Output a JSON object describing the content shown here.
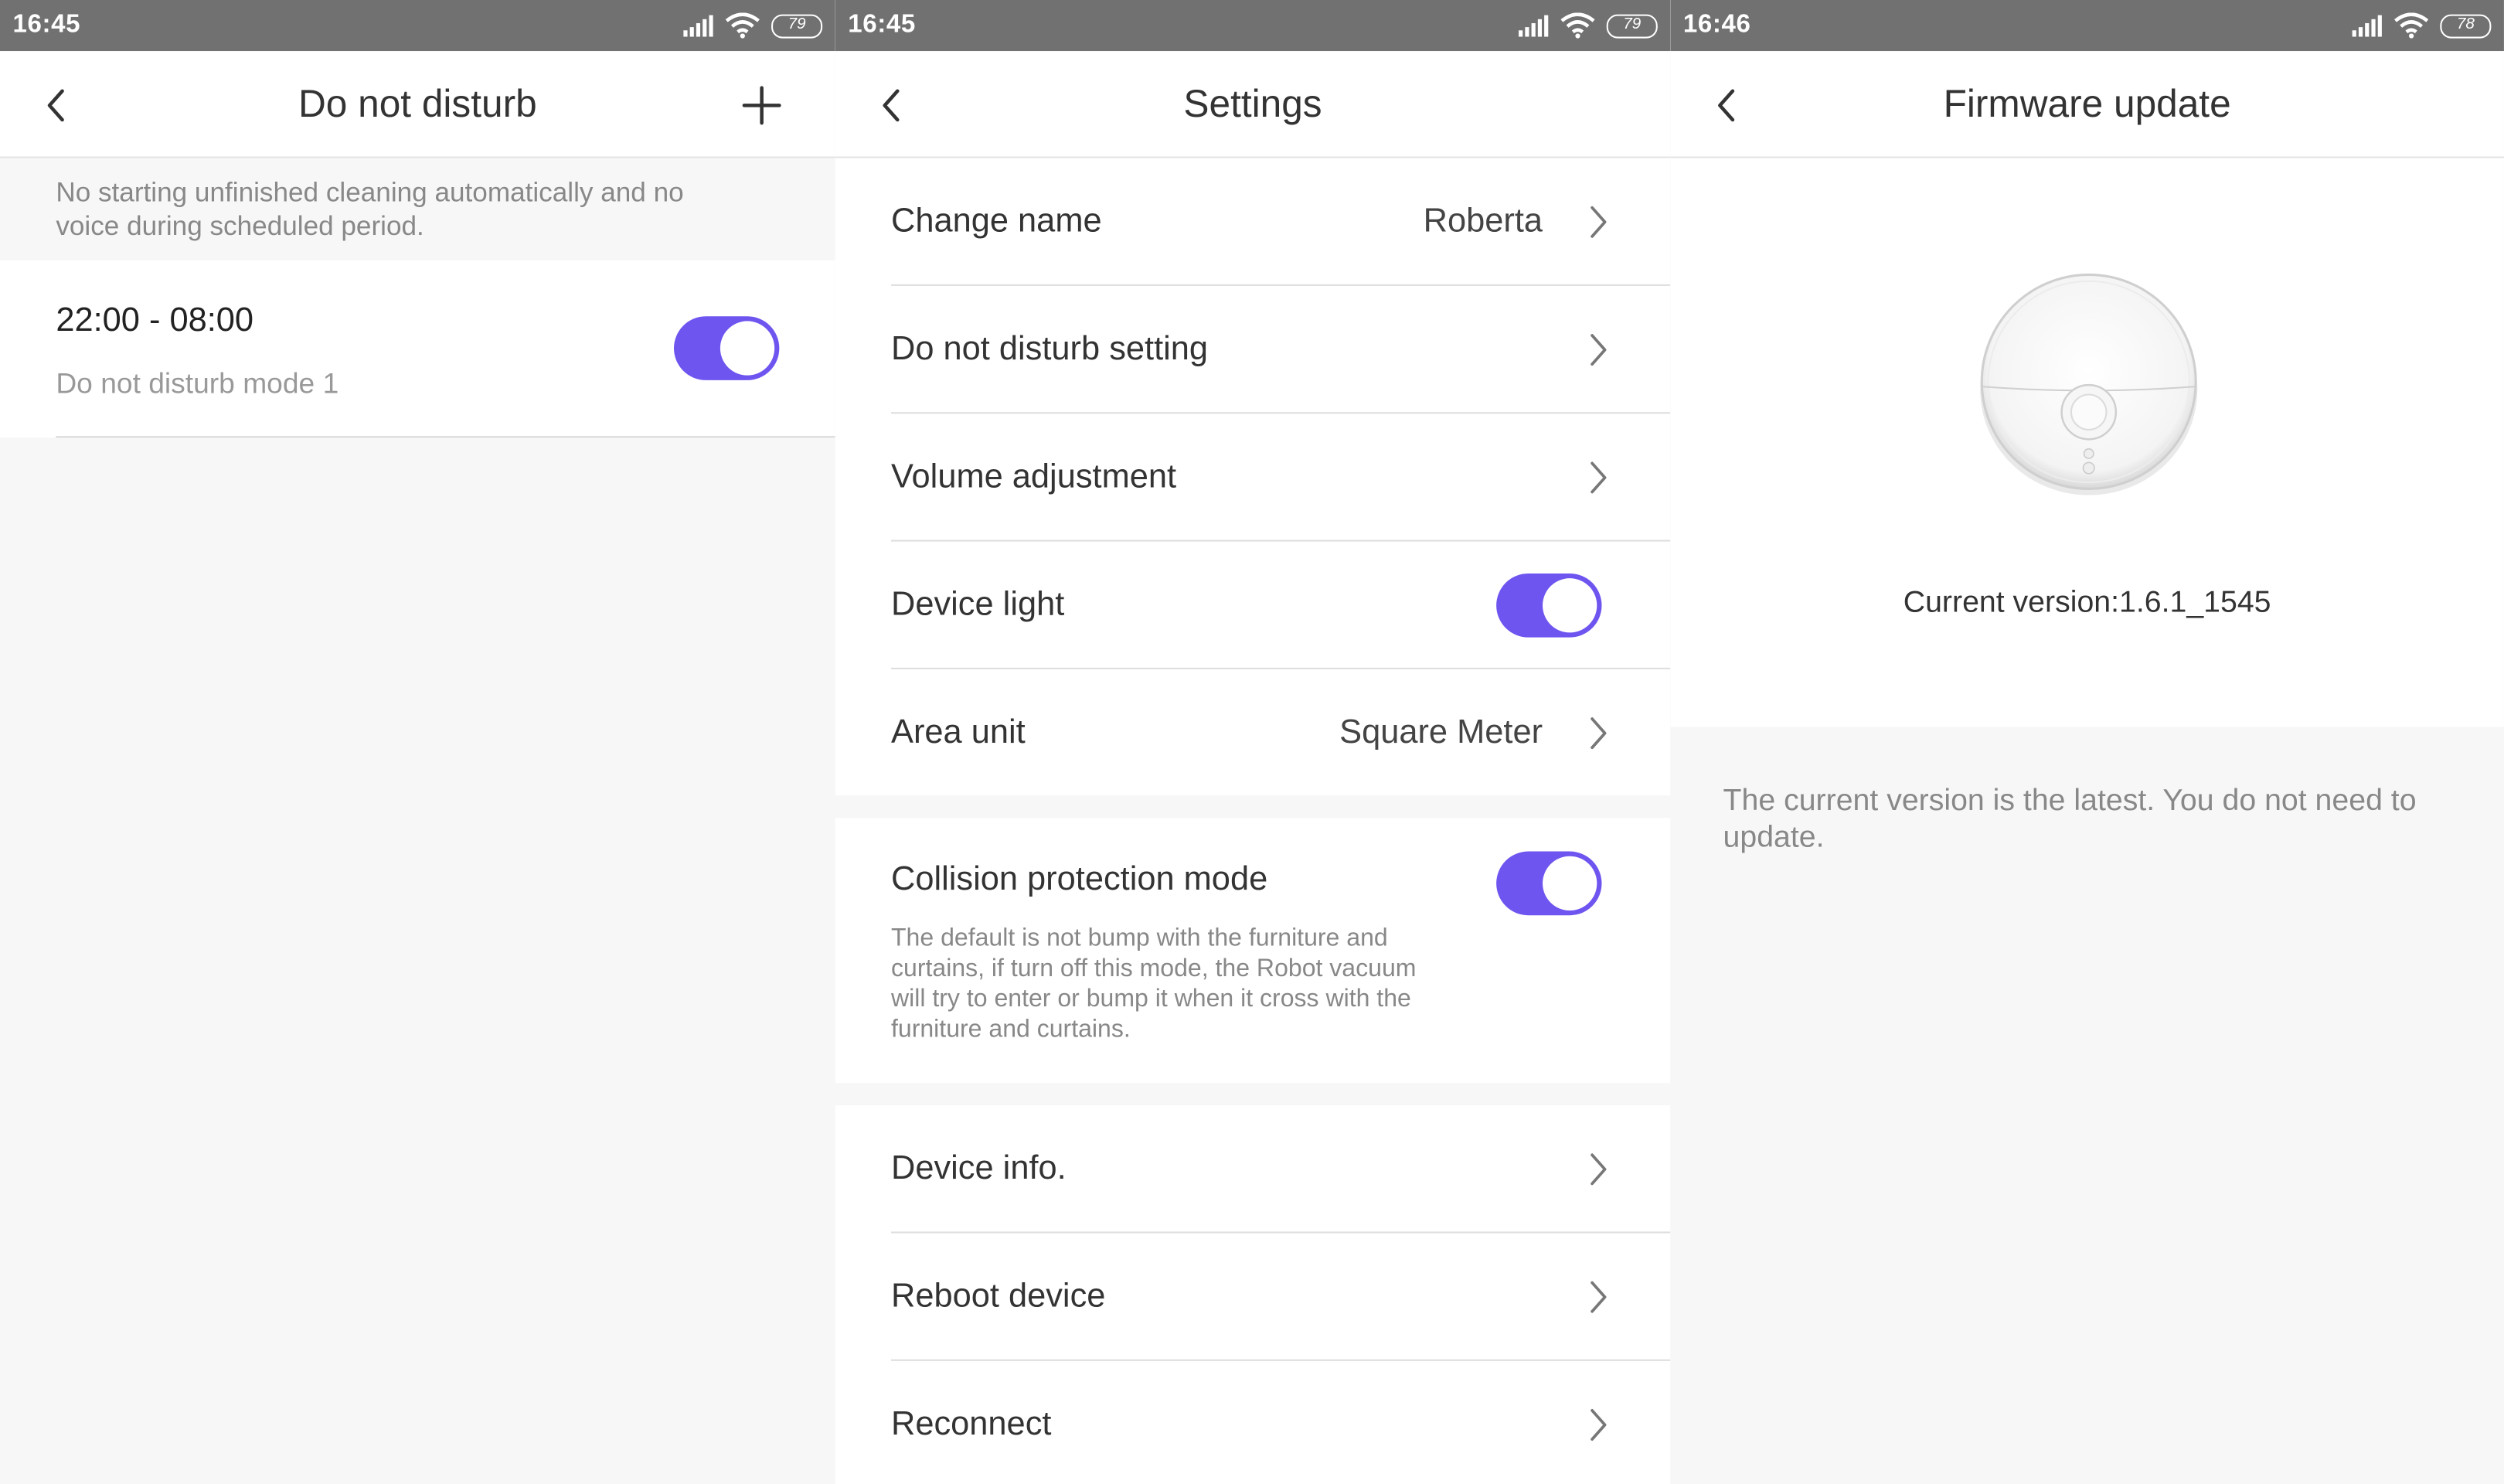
{
  "panels": [
    {
      "status": {
        "time": "16:45",
        "battery": "79"
      },
      "header": {
        "title": "Do not disturb"
      },
      "notice": "No starting unfinished cleaning automatically and no voice during scheduled period.",
      "schedule": {
        "time_range": "22:00 - 08:00",
        "mode_name": "Do not disturb mode 1",
        "enabled": true
      }
    },
    {
      "status": {
        "time": "16:45",
        "battery": "79"
      },
      "header": {
        "title": "Settings"
      },
      "rows": [
        {
          "label": "Change name",
          "value": "Roberta"
        },
        {
          "label": "Do not disturb setting",
          "value": ""
        },
        {
          "label": "Volume adjustment",
          "value": ""
        },
        {
          "label": "Device light",
          "toggle": true
        },
        {
          "label": "Area unit",
          "value": "Square Meter"
        }
      ],
      "collision": {
        "label": "Collision protection mode",
        "description": "The default is not bump with the furniture and curtains, if turn off this mode, the Robot vacuum will try to enter or bump it when it cross with the furniture and curtains.",
        "toggle": true
      },
      "rows2": [
        {
          "label": "Device info."
        },
        {
          "label": "Reboot device"
        },
        {
          "label": "Reconnect"
        }
      ]
    },
    {
      "status": {
        "time": "16:46",
        "battery": "78"
      },
      "header": {
        "title": "Firmware update"
      },
      "current_version": "Current version:1.6.1_1545",
      "message": "The current version is the latest. You do not need to update."
    }
  ],
  "colors": {
    "accent": "#6f55f0",
    "statusbar": "#717171",
    "background": "#f7f7f7"
  },
  "icons": {
    "back": "chevron-left-icon",
    "add": "plus-icon",
    "row": "chevron-right-icon"
  }
}
